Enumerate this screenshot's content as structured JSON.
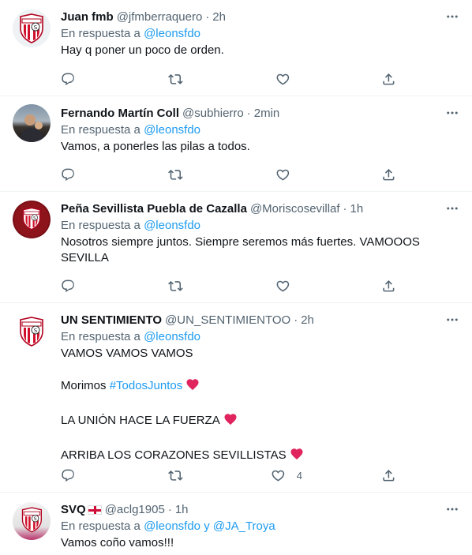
{
  "colors": {
    "accent": "#1d9bf0",
    "muted": "#536471",
    "heart": "#f4212e",
    "text": "#0f1419"
  },
  "icons": {
    "reply": "reply-icon",
    "retweet": "retweet-icon",
    "like": "heart-icon",
    "share": "share-icon",
    "more": "more-icon"
  },
  "tweets": [
    {
      "name": "Juan fmb",
      "handle": "@jfmberraquero",
      "sep": "·",
      "time": "2h",
      "reply_prefix": "En respuesta a",
      "reply_to": "@leonsfdo",
      "text": "Hay q poner un poco de orden."
    },
    {
      "name": "Fernando Martín Coll",
      "handle": "@subhierro",
      "sep": "·",
      "time": "2min",
      "reply_prefix": "En respuesta a",
      "reply_to": "@leonsfdo",
      "text": "Vamos, a ponerles las pilas a todos."
    },
    {
      "name": "Peña Sevillista Puebla de Cazalla",
      "handle": "@Moriscosevillaf",
      "sep": "·",
      "time": "1h",
      "reply_prefix": "En respuesta a",
      "reply_to": "@leonsfdo",
      "text": "Nosotros siempre juntos. Siempre seremos más fuertes. VAMOOOS SEVILLA"
    },
    {
      "name": "UN SENTIMIENTO",
      "handle": "@UN_SENTIMIENTOO",
      "sep": "·",
      "time": "2h",
      "reply_prefix": "En respuesta a",
      "reply_to": "@leonsfdo",
      "lines": {
        "l1": "VAMOS VAMOS VAMOS",
        "l2_prefix": "Morimos",
        "l2_hashtag": "#TodosJuntos",
        "l3": "LA UNIÓN HACE LA FUERZA",
        "l4": "ARRIBA LOS CORAZONES SEVILLISTAS"
      },
      "like_count": "4"
    },
    {
      "name": "SVQ",
      "handle": "@aclg1905",
      "sep": "·",
      "time": "1h",
      "reply_prefix": "En respuesta a",
      "reply_to": "@leonsfdo",
      "reply_joiner": "y",
      "reply_to_2": "@JA_Troya",
      "text": "Vamos coño vamos!!!"
    }
  ]
}
